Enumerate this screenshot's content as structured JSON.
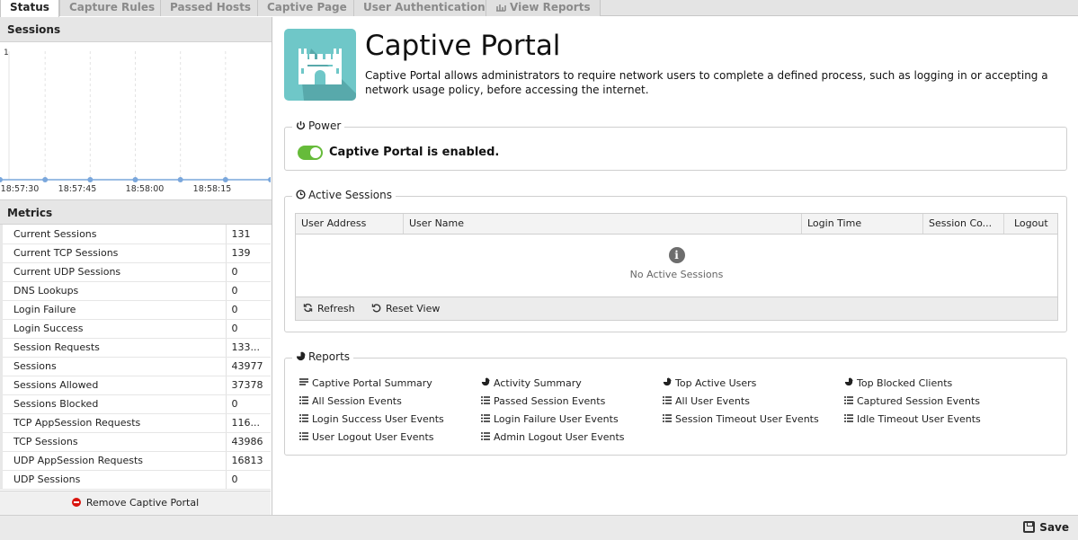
{
  "tabs": [
    {
      "label": "Status",
      "active": true
    },
    {
      "label": "Capture Rules"
    },
    {
      "label": "Passed Hosts"
    },
    {
      "label": "Captive Page"
    },
    {
      "label": "User Authentication"
    },
    {
      "label": "View Reports",
      "icon": "chart-icon"
    }
  ],
  "sessions_panel": {
    "title": "Sessions",
    "chart_data": {
      "type": "line",
      "series": [
        {
          "values": [
            0,
            0,
            0,
            0,
            0,
            0,
            0
          ]
        }
      ],
      "yticks": [
        "1"
      ],
      "xticks": [
        "18:57:30",
        "18:57:45",
        "18:58:00",
        "18:58:15"
      ],
      "ylim": [
        0,
        1
      ],
      "grid": true,
      "line_color": "#7aa7dc"
    }
  },
  "metrics": {
    "title": "Metrics",
    "rows": [
      {
        "label": "Current Sessions",
        "value": "131"
      },
      {
        "label": "Current TCP Sessions",
        "value": "139"
      },
      {
        "label": "Current UDP Sessions",
        "value": "0"
      },
      {
        "label": "DNS Lookups",
        "value": "0"
      },
      {
        "label": "Login Failure",
        "value": "0"
      },
      {
        "label": "Login Success",
        "value": "0"
      },
      {
        "label": "Session Requests",
        "value": "133..."
      },
      {
        "label": "Sessions",
        "value": "43977"
      },
      {
        "label": "Sessions Allowed",
        "value": "37378"
      },
      {
        "label": "Sessions Blocked",
        "value": "0"
      },
      {
        "label": "TCP AppSession Requests",
        "value": "116..."
      },
      {
        "label": "TCP Sessions",
        "value": "43986"
      },
      {
        "label": "UDP AppSession Requests",
        "value": "16813"
      },
      {
        "label": "UDP Sessions",
        "value": "0"
      }
    ],
    "remove_label": "Remove Captive Portal"
  },
  "app": {
    "title": "Captive Portal",
    "description": "Captive Portal allows administrators to require network users to complete a defined process, such as logging in or accepting a network usage policy, before accessing the internet.",
    "icon": "castle-icon",
    "icon_color": "#6fc7c8"
  },
  "power": {
    "legend": "Power",
    "status_text": "Captive Portal is enabled.",
    "enabled": true,
    "toggle_color": "#66bb3a"
  },
  "active_sessions": {
    "legend": "Active Sessions",
    "columns": [
      "User Address",
      "User Name",
      "Login Time",
      "Session Co...",
      "Logout"
    ],
    "empty_text": "No Active Sessions",
    "refresh_label": "Refresh",
    "reset_label": "Reset View"
  },
  "reports": {
    "legend": "Reports",
    "links": [
      [
        {
          "label": "Captive Portal Summary",
          "icon": "text-icon"
        },
        {
          "label": "All Session Events",
          "icon": "list-icon"
        },
        {
          "label": "Login Success User Events",
          "icon": "list-icon"
        },
        {
          "label": "User Logout User Events",
          "icon": "list-icon"
        }
      ],
      [
        {
          "label": "Activity Summary",
          "icon": "pie-icon"
        },
        {
          "label": "Passed Session Events",
          "icon": "list-icon"
        },
        {
          "label": "Login Failure User Events",
          "icon": "list-icon"
        },
        {
          "label": "Admin Logout User Events",
          "icon": "list-icon"
        }
      ],
      [
        {
          "label": "Top Active Users",
          "icon": "pie-icon"
        },
        {
          "label": "All User Events",
          "icon": "list-icon"
        },
        {
          "label": "Session Timeout User Events",
          "icon": "list-icon"
        }
      ],
      [
        {
          "label": "Top Blocked Clients",
          "icon": "pie-icon"
        },
        {
          "label": "Captured Session Events",
          "icon": "list-icon"
        },
        {
          "label": "Idle Timeout User Events",
          "icon": "list-icon"
        }
      ]
    ]
  },
  "footer": {
    "save_label": "Save"
  }
}
